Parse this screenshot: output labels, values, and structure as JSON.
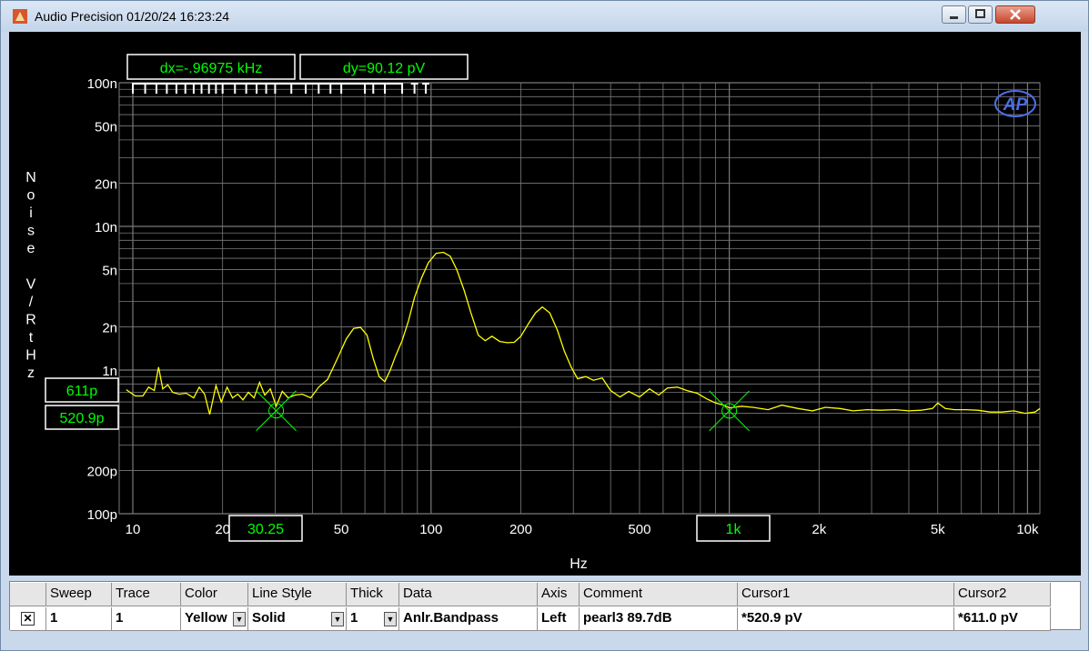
{
  "window": {
    "title": "Audio Precision  01/20/24 16:23:24"
  },
  "readouts": {
    "dx": "dx=-.96975 kHz",
    "dy": "dy=90.12  pV",
    "cursor_y_top": "611p",
    "cursor_y_bottom": "520.9p",
    "cursor_x_1": "30.25",
    "cursor_x_2": "1k"
  },
  "logo": "AP",
  "colors": {
    "trace": "#ffff00",
    "readout": "#00ff00",
    "grid": "#7a7a7a",
    "background": "#000000",
    "axis_text": "#ffffff"
  },
  "chart_data": {
    "type": "line",
    "title": "",
    "xlabel": "Hz",
    "ylabel": "Noise V/RtHz",
    "xscale": "log",
    "yscale": "log",
    "xlim": [
      9,
      11000
    ],
    "ylim": [
      1e-10,
      1e-07
    ],
    "grid": true,
    "x_tick_labels": [
      {
        "v": 10,
        "t": "10"
      },
      {
        "v": 20,
        "t": "20"
      },
      {
        "v": 50,
        "t": "50"
      },
      {
        "v": 100,
        "t": "100"
      },
      {
        "v": 200,
        "t": "200"
      },
      {
        "v": 500,
        "t": "500"
      },
      {
        "v": 2000,
        "t": "2k"
      },
      {
        "v": 5000,
        "t": "5k"
      },
      {
        "v": 10000,
        "t": "10k"
      }
    ],
    "y_tick_labels": [
      {
        "v": 1e-07,
        "t": "100n"
      },
      {
        "v": 5e-08,
        "t": "50n"
      },
      {
        "v": 2e-08,
        "t": "20n"
      },
      {
        "v": 1e-08,
        "t": "10n"
      },
      {
        "v": 5e-09,
        "t": "5n"
      },
      {
        "v": 2e-09,
        "t": "2n"
      },
      {
        "v": 1e-09,
        "t": "1n"
      },
      {
        "v": 2e-10,
        "t": "200p"
      },
      {
        "v": 1e-10,
        "t": "100p"
      }
    ],
    "cursors": [
      {
        "name": "Cursor1",
        "x": 30.25,
        "y": 5.209e-10
      },
      {
        "name": "Cursor2",
        "x": 1000,
        "y": 6.11e-10
      }
    ],
    "series": [
      {
        "name": "Anlr.Bandpass",
        "color": "Yellow",
        "x": [
          9.5,
          10.2,
          10.8,
          11.3,
          11.8,
          12.2,
          12.6,
          13.1,
          13.6,
          14.3,
          15.1,
          16,
          16.7,
          17.4,
          18.1,
          19,
          19.8,
          20.7,
          21.6,
          22.5,
          23.4,
          24.4,
          25.5,
          26.6,
          27.7,
          28.9,
          30.25,
          31.7,
          33.2,
          35,
          37,
          39.5,
          42,
          45,
          48.5,
          52,
          55,
          58,
          61,
          64,
          67,
          70,
          73,
          76,
          80,
          84,
          88,
          93,
          98,
          104,
          110,
          116,
          122,
          129,
          136,
          144,
          152,
          160,
          170,
          180,
          190,
          200,
          212,
          224,
          236,
          250,
          265,
          280,
          295,
          310,
          330,
          350,
          375,
          400,
          430,
          460,
          500,
          540,
          580,
          620,
          670,
          720,
          780,
          840,
          900,
          960,
          1000,
          1100,
          1200,
          1350,
          1500,
          1700,
          1900,
          2100,
          2350,
          2600,
          2900,
          3200,
          3600,
          4000,
          4400,
          4800,
          5000,
          5300,
          5700,
          6200,
          6800,
          7500,
          8200,
          9000,
          9800,
          10600,
          11000
        ],
        "y": [
          7.3e-10,
          6.6e-10,
          6.6e-10,
          7.6e-10,
          7.2e-10,
          1.05e-09,
          7.4e-10,
          7.9e-10,
          7e-10,
          6.8e-10,
          6.9e-10,
          6.4e-10,
          7.6e-10,
          6.8e-10,
          4.9e-10,
          7.8e-10,
          6e-10,
          7.6e-10,
          6.4e-10,
          6.8e-10,
          6.2e-10,
          7e-10,
          6.4e-10,
          8.2e-10,
          6.7e-10,
          7.4e-10,
          5.6e-10,
          7.1e-10,
          6.4e-10,
          6.7e-10,
          6.8e-10,
          6.4e-10,
          7.6e-10,
          8.6e-10,
          1.2e-09,
          1.65e-09,
          1.95e-09,
          1.98e-09,
          1.75e-09,
          1.2e-09,
          9e-10,
          8.3e-10,
          1e-09,
          1.25e-09,
          1.6e-09,
          2.2e-09,
          3.2e-09,
          4.4e-09,
          5.6e-09,
          6.5e-09,
          6.6e-09,
          6.2e-09,
          5e-09,
          3.6e-09,
          2.5e-09,
          1.75e-09,
          1.6e-09,
          1.72e-09,
          1.58e-09,
          1.55e-09,
          1.56e-09,
          1.72e-09,
          2.1e-09,
          2.5e-09,
          2.75e-09,
          2.5e-09,
          1.9e-09,
          1.35e-09,
          1.05e-09,
          8.7e-10,
          9e-10,
          8.5e-10,
          8.8e-10,
          7.2e-10,
          6.5e-10,
          7.1e-10,
          6.5e-10,
          7.4e-10,
          6.7e-10,
          7.5e-10,
          7.6e-10,
          7.2e-10,
          6.9e-10,
          6.3e-10,
          5.9e-10,
          5.7e-10,
          5.45e-10,
          5.6e-10,
          5.5e-10,
          5.3e-10,
          5.7e-10,
          5.4e-10,
          5.2e-10,
          5.5e-10,
          5.4e-10,
          5.2e-10,
          5.3e-10,
          5.25e-10,
          5.3e-10,
          5.2e-10,
          5.25e-10,
          5.4e-10,
          5.9e-10,
          5.4e-10,
          5.3e-10,
          5.3e-10,
          5.25e-10,
          5.1e-10,
          5.1e-10,
          5.2e-10,
          5e-10,
          5.1e-10,
          5.4e-10
        ]
      }
    ]
  },
  "table": {
    "headers": [
      "Sweep",
      "Trace",
      "Color",
      "Line Style",
      "Thick",
      "Data",
      "Axis",
      "Comment",
      "Cursor1",
      "Cursor2"
    ],
    "row": {
      "checked": "✕",
      "sweep": "1",
      "trace": "1",
      "color": "Yellow",
      "line_style": "Solid",
      "thick": "1",
      "data": "Anlr.Bandpass",
      "axis": "Left",
      "comment": "pearl3 89.7dB",
      "cursor1": "*520.9  pV",
      "cursor2": "*611.0  pV"
    }
  }
}
